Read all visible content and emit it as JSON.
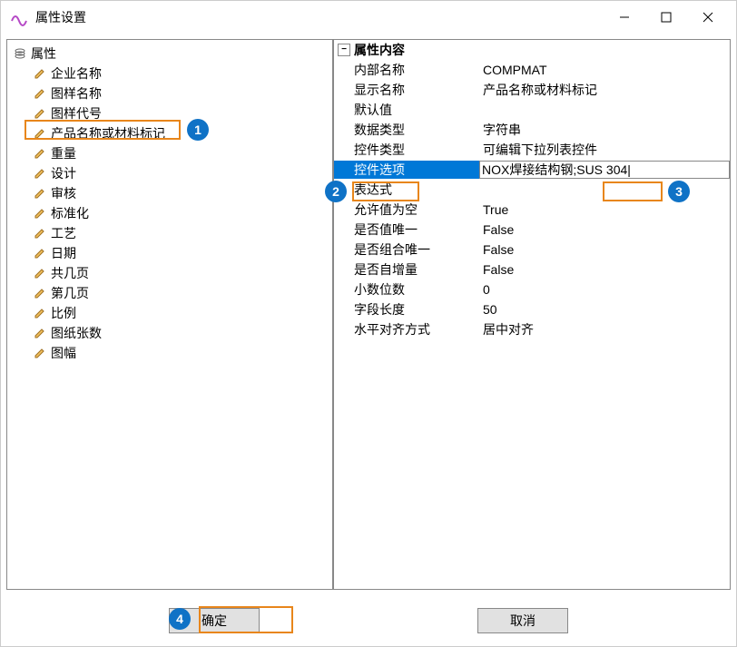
{
  "window": {
    "title": "属性设置"
  },
  "tree": {
    "root": "属性",
    "items": [
      "企业名称",
      "图样名称",
      "图样代号",
      "产品名称或材料标记",
      "重量",
      "设计",
      "审核",
      "标准化",
      "工艺",
      "日期",
      "共几页",
      "第几页",
      "比例",
      "图纸张数",
      "图幅"
    ]
  },
  "grid": {
    "header": "属性内容",
    "rows": [
      {
        "label": "内部名称",
        "value": "COMPMAT"
      },
      {
        "label": "显示名称",
        "value": "产品名称或材料标记"
      },
      {
        "label": "默认值",
        "value": ""
      },
      {
        "label": "数据类型",
        "value": "字符串"
      },
      {
        "label": "控件类型",
        "value": "可编辑下拉列表控件"
      },
      {
        "label": "控件选项",
        "value": "NOX焊接结构钢;SUS 304|",
        "selected": true,
        "editable": true
      },
      {
        "label": "表达式",
        "value": ""
      },
      {
        "label": "允许值为空",
        "value": "True"
      },
      {
        "label": "是否值唯一",
        "value": "False"
      },
      {
        "label": "是否组合唯一",
        "value": "False"
      },
      {
        "label": "是否自增量",
        "value": "False"
      },
      {
        "label": "小数位数",
        "value": "0"
      },
      {
        "label": "字段长度",
        "value": "50"
      },
      {
        "label": "水平对齐方式",
        "value": "居中对齐"
      }
    ]
  },
  "footer": {
    "ok": "确定",
    "cancel": "取消"
  },
  "callouts": [
    "1",
    "2",
    "3",
    "4"
  ]
}
